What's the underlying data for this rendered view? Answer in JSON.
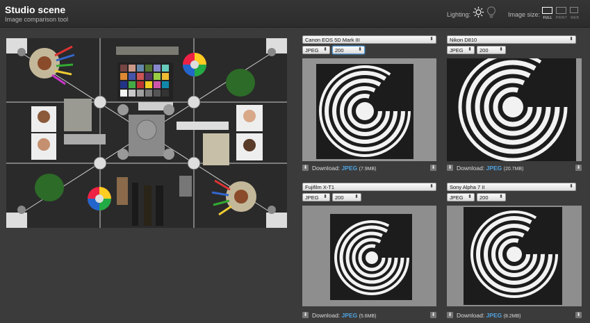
{
  "header": {
    "title": "Studio scene",
    "subtitle": "Image comparison tool",
    "lighting_label": "Lighting:",
    "image_size_label": "Image size:",
    "size_options": [
      "FULL",
      "PRINT",
      "WEB"
    ],
    "active_size": "FULL"
  },
  "panels": [
    {
      "camera": "Canon EOS 5D Mark III",
      "format": "JPEG",
      "iso": "200",
      "download_label": "Download:",
      "download_format": "JPEG",
      "download_size": "(7.9MB)"
    },
    {
      "camera": "Nikon D810",
      "format": "JPEG",
      "iso": "200",
      "download_label": "Download:",
      "download_format": "JPEG",
      "download_size": "(20.7MB)"
    },
    {
      "camera": "Fujifilm X-T1",
      "format": "JPEG",
      "iso": "200",
      "download_label": "Download:",
      "download_format": "JPEG",
      "download_size": "(5.6MB)"
    },
    {
      "camera": "Sony Alpha 7 II",
      "format": "JPEG",
      "iso": "200",
      "download_label": "Download:",
      "download_format": "JPEG",
      "download_size": "(8.2MB)"
    }
  ],
  "colors": {
    "accent": "#4fa3e0",
    "background": "#3b3b3b",
    "topbar": "#2f2f2f"
  },
  "icons": {
    "lighting_on": "sun-icon",
    "lighting_off": "bulb-icon",
    "download": "download-icon"
  }
}
